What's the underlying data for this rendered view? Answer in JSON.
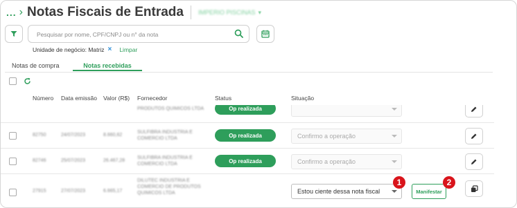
{
  "header": {
    "breadcrumb": "...",
    "chevron": "›",
    "title": "Notas Fiscais de Entrada",
    "company": "IMPERIO PISCINAS"
  },
  "filters": {
    "filter_icon": "filter-icon",
    "search_placeholder": "Pesquisar por nome, CPF/CNPJ ou n° da nota",
    "search_icon": "search-icon",
    "calendar_icon": "calendar-icon",
    "unit_label": "Unidade de negócio: Matriz",
    "unit_remove": "×",
    "clear": "Limpar"
  },
  "tabs": [
    {
      "label": "Notas de compra",
      "active": false
    },
    {
      "label": "Notas recebidas",
      "active": true
    }
  ],
  "toolbar": {
    "refresh_icon": "refresh-icon"
  },
  "columns": [
    "Número",
    "Data emissão",
    "Valor (R$)",
    "Fornecedor",
    "Status",
    "Situação"
  ],
  "rows": [
    {
      "numero": "",
      "data": "",
      "valor": "",
      "fornecedor": "PRODUTOS QUIMICOS LTDA",
      "status": "Op realizada",
      "situacao": "",
      "action_icon": "edit-icon"
    },
    {
      "numero": "82750",
      "data": "24/07/2023",
      "valor": "8.660,62",
      "fornecedor": "SULFIBRA INDUSTRIA E COMERCIO LTDA",
      "status": "Op realizada",
      "situacao": "Confirmo a operação",
      "action_icon": "edit-icon"
    },
    {
      "numero": "82746",
      "data": "25/07/2023",
      "valor": "26.467,28",
      "fornecedor": "SULFIBRA INDUSTRIA E COMERCIO LTDA",
      "status": "Op realizada",
      "situacao": "Confirmo a operação",
      "action_icon": "edit-icon"
    },
    {
      "numero": "27915",
      "data": "27/07/2023",
      "valor": "6.665,17",
      "fornecedor": "DILUTEC INDUSTRIA E COMERCIO DE PRODUTOS QUIMICOS LTDA",
      "status": "",
      "situacao": "Estou ciente dessa nota fiscal",
      "manifest": "Manifestar",
      "action_icon": "copy-icon"
    }
  ],
  "markers": [
    "1",
    "2"
  ],
  "colors": {
    "brand": "#2e9e5b",
    "marker": "#d9141b",
    "link": "#2e8fd8"
  }
}
